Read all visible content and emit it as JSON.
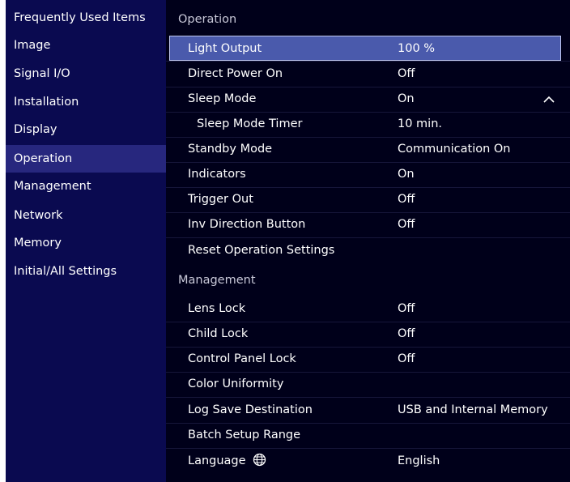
{
  "sidebar": {
    "items": [
      {
        "label": "Frequently Used Items"
      },
      {
        "label": "Image"
      },
      {
        "label": "Signal I/O"
      },
      {
        "label": "Installation"
      },
      {
        "label": "Display"
      },
      {
        "label": "Operation",
        "selected": true
      },
      {
        "label": "Management"
      },
      {
        "label": "Network"
      },
      {
        "label": "Memory"
      },
      {
        "label": "Initial/All Settings"
      }
    ]
  },
  "operation": {
    "header": "Operation",
    "rows": [
      {
        "label": "Light Output",
        "value": "100 %"
      },
      {
        "label": "Direct Power On",
        "value": "Off"
      },
      {
        "label": "Sleep Mode",
        "value": "On"
      },
      {
        "label": "Sleep Mode Timer",
        "value": "10 min."
      },
      {
        "label": "Standby Mode",
        "value": "Communication On"
      },
      {
        "label": "Indicators",
        "value": "On"
      },
      {
        "label": "Trigger Out",
        "value": "Off"
      },
      {
        "label": "Inv Direction Button",
        "value": "Off"
      },
      {
        "label": "Reset Operation Settings",
        "value": ""
      }
    ]
  },
  "management": {
    "header": "Management",
    "rows": [
      {
        "label": "Lens Lock",
        "value": "Off"
      },
      {
        "label": "Child Lock",
        "value": "Off"
      },
      {
        "label": "Control Panel Lock",
        "value": "Off"
      },
      {
        "label": "Color Uniformity",
        "value": ""
      },
      {
        "label": "Log Save Destination",
        "value": "USB and Internal Memory"
      },
      {
        "label": "Batch Setup Range",
        "value": ""
      },
      {
        "label": "Language",
        "value": "English"
      }
    ]
  },
  "icons": {
    "collapse": "chevron-up-icon",
    "language": "globe-icon"
  },
  "colors": {
    "background": "#00001a",
    "sidebar": "#0a0a50",
    "sidebar_selected": "#27277e",
    "row_selected": "#4a5aac",
    "text": "#ffffff"
  }
}
